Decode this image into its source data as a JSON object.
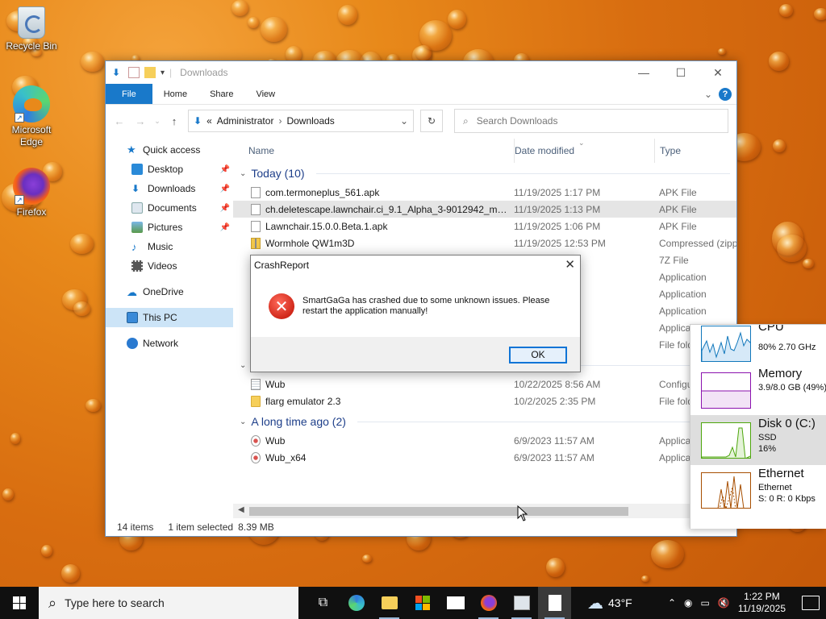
{
  "desktop": {
    "icons": [
      {
        "label": "Recycle Bin"
      },
      {
        "label": "Microsoft Edge"
      },
      {
        "label": "Firefox"
      }
    ]
  },
  "explorer": {
    "title": "Downloads",
    "ribbon": {
      "file": "File",
      "home": "Home",
      "share": "Share",
      "view": "View",
      "help": "?"
    },
    "address": {
      "root": "«",
      "crumb1": "Administrator",
      "crumb2": "Downloads"
    },
    "search": {
      "placeholder": "Search Downloads"
    },
    "nav": {
      "quick_access": "Quick access",
      "desktop": "Desktop",
      "downloads": "Downloads",
      "documents": "Documents",
      "pictures": "Pictures",
      "music": "Music",
      "videos": "Videos",
      "onedrive": "OneDrive",
      "this_pc": "This PC",
      "network": "Network"
    },
    "columns": {
      "name": "Name",
      "date": "Date modified",
      "type": "Type"
    },
    "groups": [
      {
        "label": "Today (10)",
        "rows": [
          {
            "name": "com.termoneplus_561.apk",
            "date": "11/19/2025 1:17 PM",
            "type": "APK File",
            "icon": "apk"
          },
          {
            "name": "ch.deletescape.lawnchair.ci_9.1_Alpha_3-9012942_min...",
            "date": "11/19/2025 1:13 PM",
            "type": "APK File",
            "icon": "apk"
          },
          {
            "name": "Lawnchair.15.0.0.Beta.1.apk",
            "date": "11/19/2025 1:06 PM",
            "type": "APK File",
            "icon": "apk"
          },
          {
            "name": "Wormhole QW1m3D",
            "date": "11/19/2025 12:53 PM",
            "type": "Compressed (zippe",
            "icon": "zip"
          },
          {
            "name": "",
            "date": "0 PM",
            "type": "7Z File",
            "icon": "zip"
          },
          {
            "name": "",
            "date": "4 PM",
            "type": "Application",
            "icon": "app"
          },
          {
            "name": "",
            "date": "2 PM",
            "type": "Application",
            "icon": "app"
          },
          {
            "name": "",
            "date": "1 PM",
            "type": "Application",
            "icon": "app"
          },
          {
            "name": "",
            "date": "6 PM",
            "type": "Applica",
            "icon": "app"
          },
          {
            "name": "",
            "date": "4 PM",
            "type": "File fold",
            "icon": "folder"
          }
        ]
      },
      {
        "label": "Last month (2)",
        "rows": [
          {
            "name": "Wub",
            "date": "10/22/2025 8:56 AM",
            "type": "Configu",
            "icon": "cfg"
          },
          {
            "name": "flarg emulator 2.3",
            "date": "10/2/2025 2:35 PM",
            "type": "File fold",
            "icon": "folder"
          }
        ]
      },
      {
        "label": "A long time ago (2)",
        "rows": [
          {
            "name": "Wub",
            "date": "6/9/2023 11:57 AM",
            "type": "Applica",
            "icon": "app"
          },
          {
            "name": "Wub_x64",
            "date": "6/9/2023 11:57 AM",
            "type": "Applica",
            "icon": "app"
          }
        ]
      }
    ],
    "status": {
      "items": "14 items",
      "selected": "1 item selected",
      "size": "8.39 MB"
    }
  },
  "dialog": {
    "title": "CrashReport",
    "message": "SmartGaGa has crashed due to some unknown issues. Please restart the application manually!",
    "ok": "OK"
  },
  "perf": {
    "cpu": {
      "title": "CPU",
      "sub": "80%  2.70 GHz"
    },
    "memory": {
      "title": "Memory",
      "sub": "3.9/8.0 GB (49%)"
    },
    "disk": {
      "title": "Disk 0 (C:)",
      "sub1": "SSD",
      "sub2": "16%"
    },
    "ethernet": {
      "title": "Ethernet",
      "sub1": "Ethernet",
      "sub2": "S: 0  R: 0 Kbps"
    }
  },
  "taskbar": {
    "search_placeholder": "Type here to search",
    "weather": "43°F",
    "time": "1:22 PM",
    "date": "11/19/2025"
  },
  "colors": {
    "accent": "#1979ca",
    "error": "#d0281a"
  }
}
